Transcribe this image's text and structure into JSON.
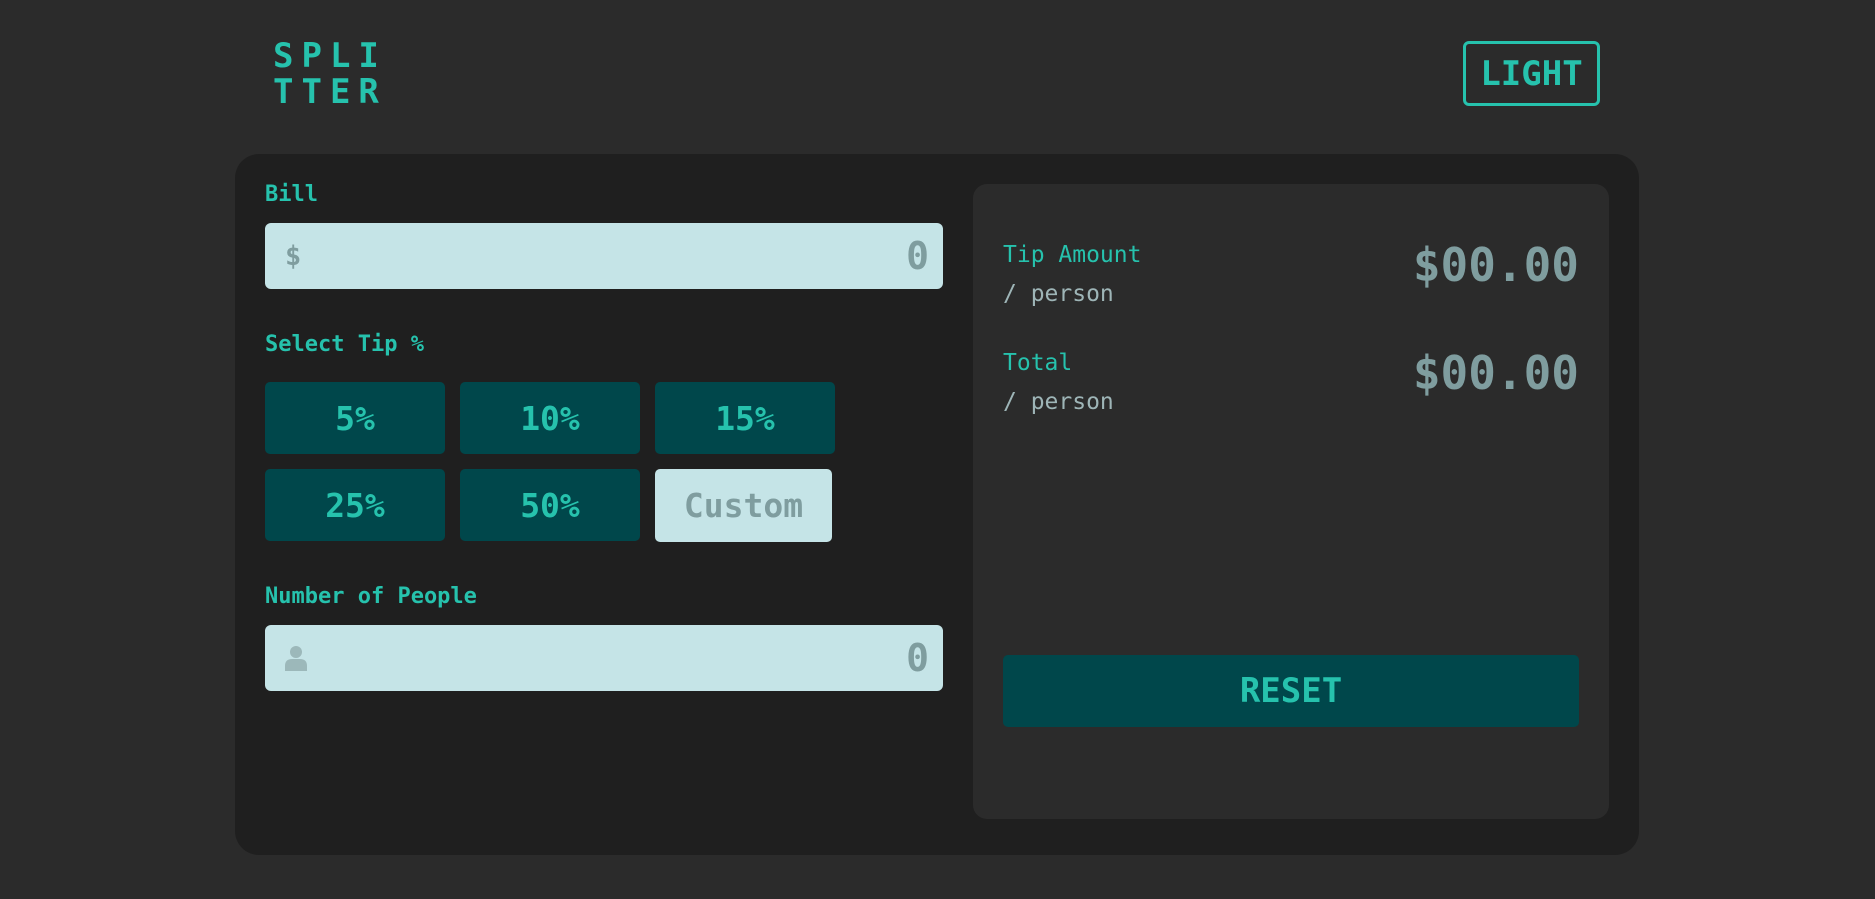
{
  "header": {
    "logo_line1": "SPLI",
    "logo_line2": "TTER",
    "theme_toggle_label": "LIGHT"
  },
  "form": {
    "bill_label": "Bill",
    "bill_prefix": "$",
    "bill_placeholder": "0",
    "tip_label": "Select Tip %",
    "tip_options": [
      "5%",
      "10%",
      "15%",
      "25%",
      "50%"
    ],
    "custom_placeholder": "Custom",
    "people_label": "Number of People",
    "people_placeholder": "0"
  },
  "results": {
    "tip_title": "Tip Amount",
    "tip_sub": "/ person",
    "tip_value": "$00.00",
    "total_title": "Total",
    "total_sub": "/ person",
    "total_value": "$00.00",
    "reset_label": "RESET"
  },
  "icons": {
    "bill_prefix": "dollar-icon",
    "people_prefix": "person-icon"
  },
  "colors": {
    "background": "#2b2b2b",
    "card": "#1f1f1f",
    "accent": "#26c2ad",
    "button": "#00474b",
    "input": "#c5e4e7",
    "muted": "#7f9d9f"
  }
}
